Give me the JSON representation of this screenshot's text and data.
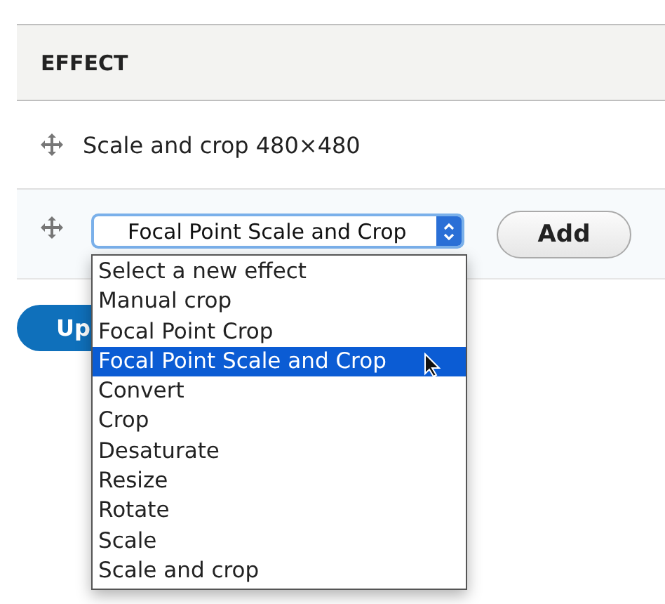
{
  "table": {
    "header": "EFFECT",
    "rows": [
      {
        "label": "Scale and crop 480×480"
      }
    ]
  },
  "new_effect": {
    "select_value": "Focal Point Scale and Crop",
    "add_button": "Add"
  },
  "dropdown": {
    "options": [
      {
        "label": "Select a new effect",
        "selected": false
      },
      {
        "label": "Manual crop",
        "selected": false
      },
      {
        "label": "Focal Point Crop",
        "selected": false
      },
      {
        "label": "Focal Point Scale and Crop",
        "selected": true
      },
      {
        "label": "Convert",
        "selected": false
      },
      {
        "label": "Crop",
        "selected": false
      },
      {
        "label": "Desaturate",
        "selected": false
      },
      {
        "label": "Resize",
        "selected": false
      },
      {
        "label": "Rotate",
        "selected": false
      },
      {
        "label": "Scale",
        "selected": false
      },
      {
        "label": "Scale and crop",
        "selected": false
      }
    ]
  },
  "update_button": {
    "label": "Up"
  }
}
